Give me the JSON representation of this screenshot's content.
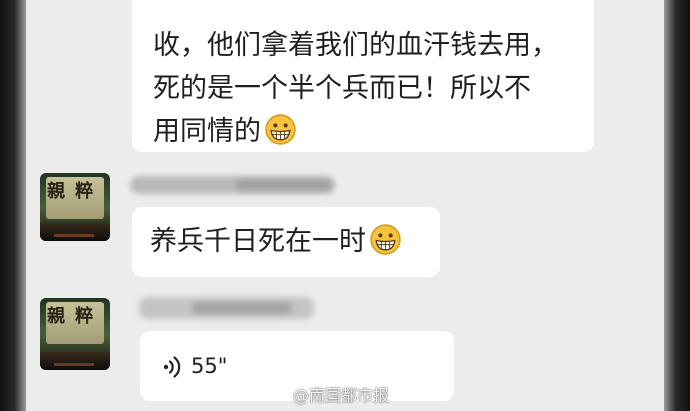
{
  "messages": [
    {
      "sender": "other",
      "type": "text",
      "lines": [
        "收，他们拿着我们的血汗钱去用，",
        "死的是一个半个兵而已！所以不",
        "用同情的"
      ],
      "emoji": "grinning-face"
    },
    {
      "sender": "other",
      "type": "text",
      "lines": [
        "养兵千日死在一时"
      ],
      "emoji": "grinning-face"
    },
    {
      "sender": "other",
      "type": "voice",
      "duration": "55\""
    }
  ],
  "watermark": "@南国都市报",
  "colors": {
    "chat_background": "#ececec",
    "bubble_background": "#ffffff",
    "text": "#1f1f1f",
    "emoji": "#f6c340"
  }
}
